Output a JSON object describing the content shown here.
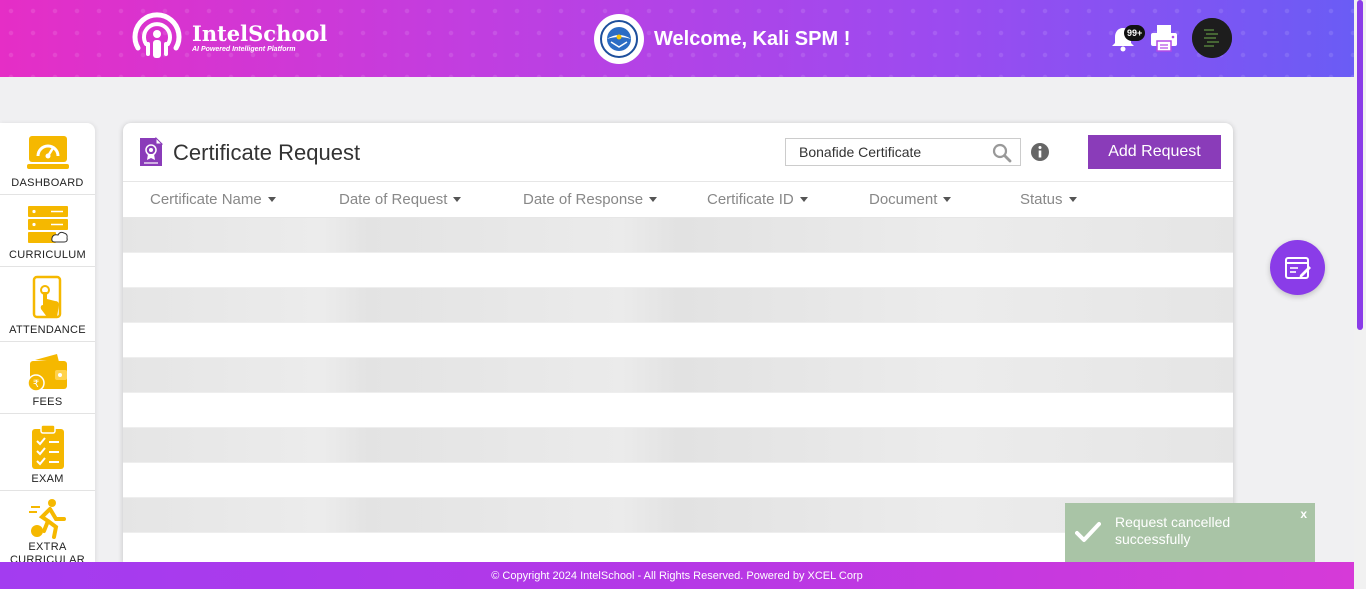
{
  "header": {
    "brand_name": "IntelSchool",
    "brand_tagline": "AI Powered Intelligent Platform",
    "welcome": "Welcome, Kali SPM !",
    "notification_count": "99+"
  },
  "sidebar": {
    "items": [
      {
        "label": "DASHBOARD",
        "icon": "dashboard-icon"
      },
      {
        "label": "CURRICULUM",
        "icon": "curriculum-icon"
      },
      {
        "label": "ATTENDANCE",
        "icon": "attendance-icon"
      },
      {
        "label": "FEES",
        "icon": "fees-icon"
      },
      {
        "label": "EXAM",
        "icon": "exam-icon"
      },
      {
        "label": "EXTRA CURRICULAR",
        "icon": "extra-curricular-icon"
      }
    ]
  },
  "main": {
    "title": "Certificate Request",
    "search_value": "Bonafide Certificate",
    "add_button": "Add Request",
    "columns": [
      "Certificate Name",
      "Date of Request",
      "Date of Response",
      "Certificate ID",
      "Document",
      "Status"
    ]
  },
  "toast": {
    "message": "Request cancelled successfully",
    "close": "x"
  },
  "footer": {
    "text": "© Copyright 2024 IntelSchool - All Rights Reserved. Powered by XCEL Corp"
  },
  "colors": {
    "accent": "#8a3cb9",
    "header_start": "#e52ec6",
    "header_end": "#6a5cf5",
    "sidebar_icon": "#f5b800",
    "toast_bg": "#a9c4a6"
  }
}
